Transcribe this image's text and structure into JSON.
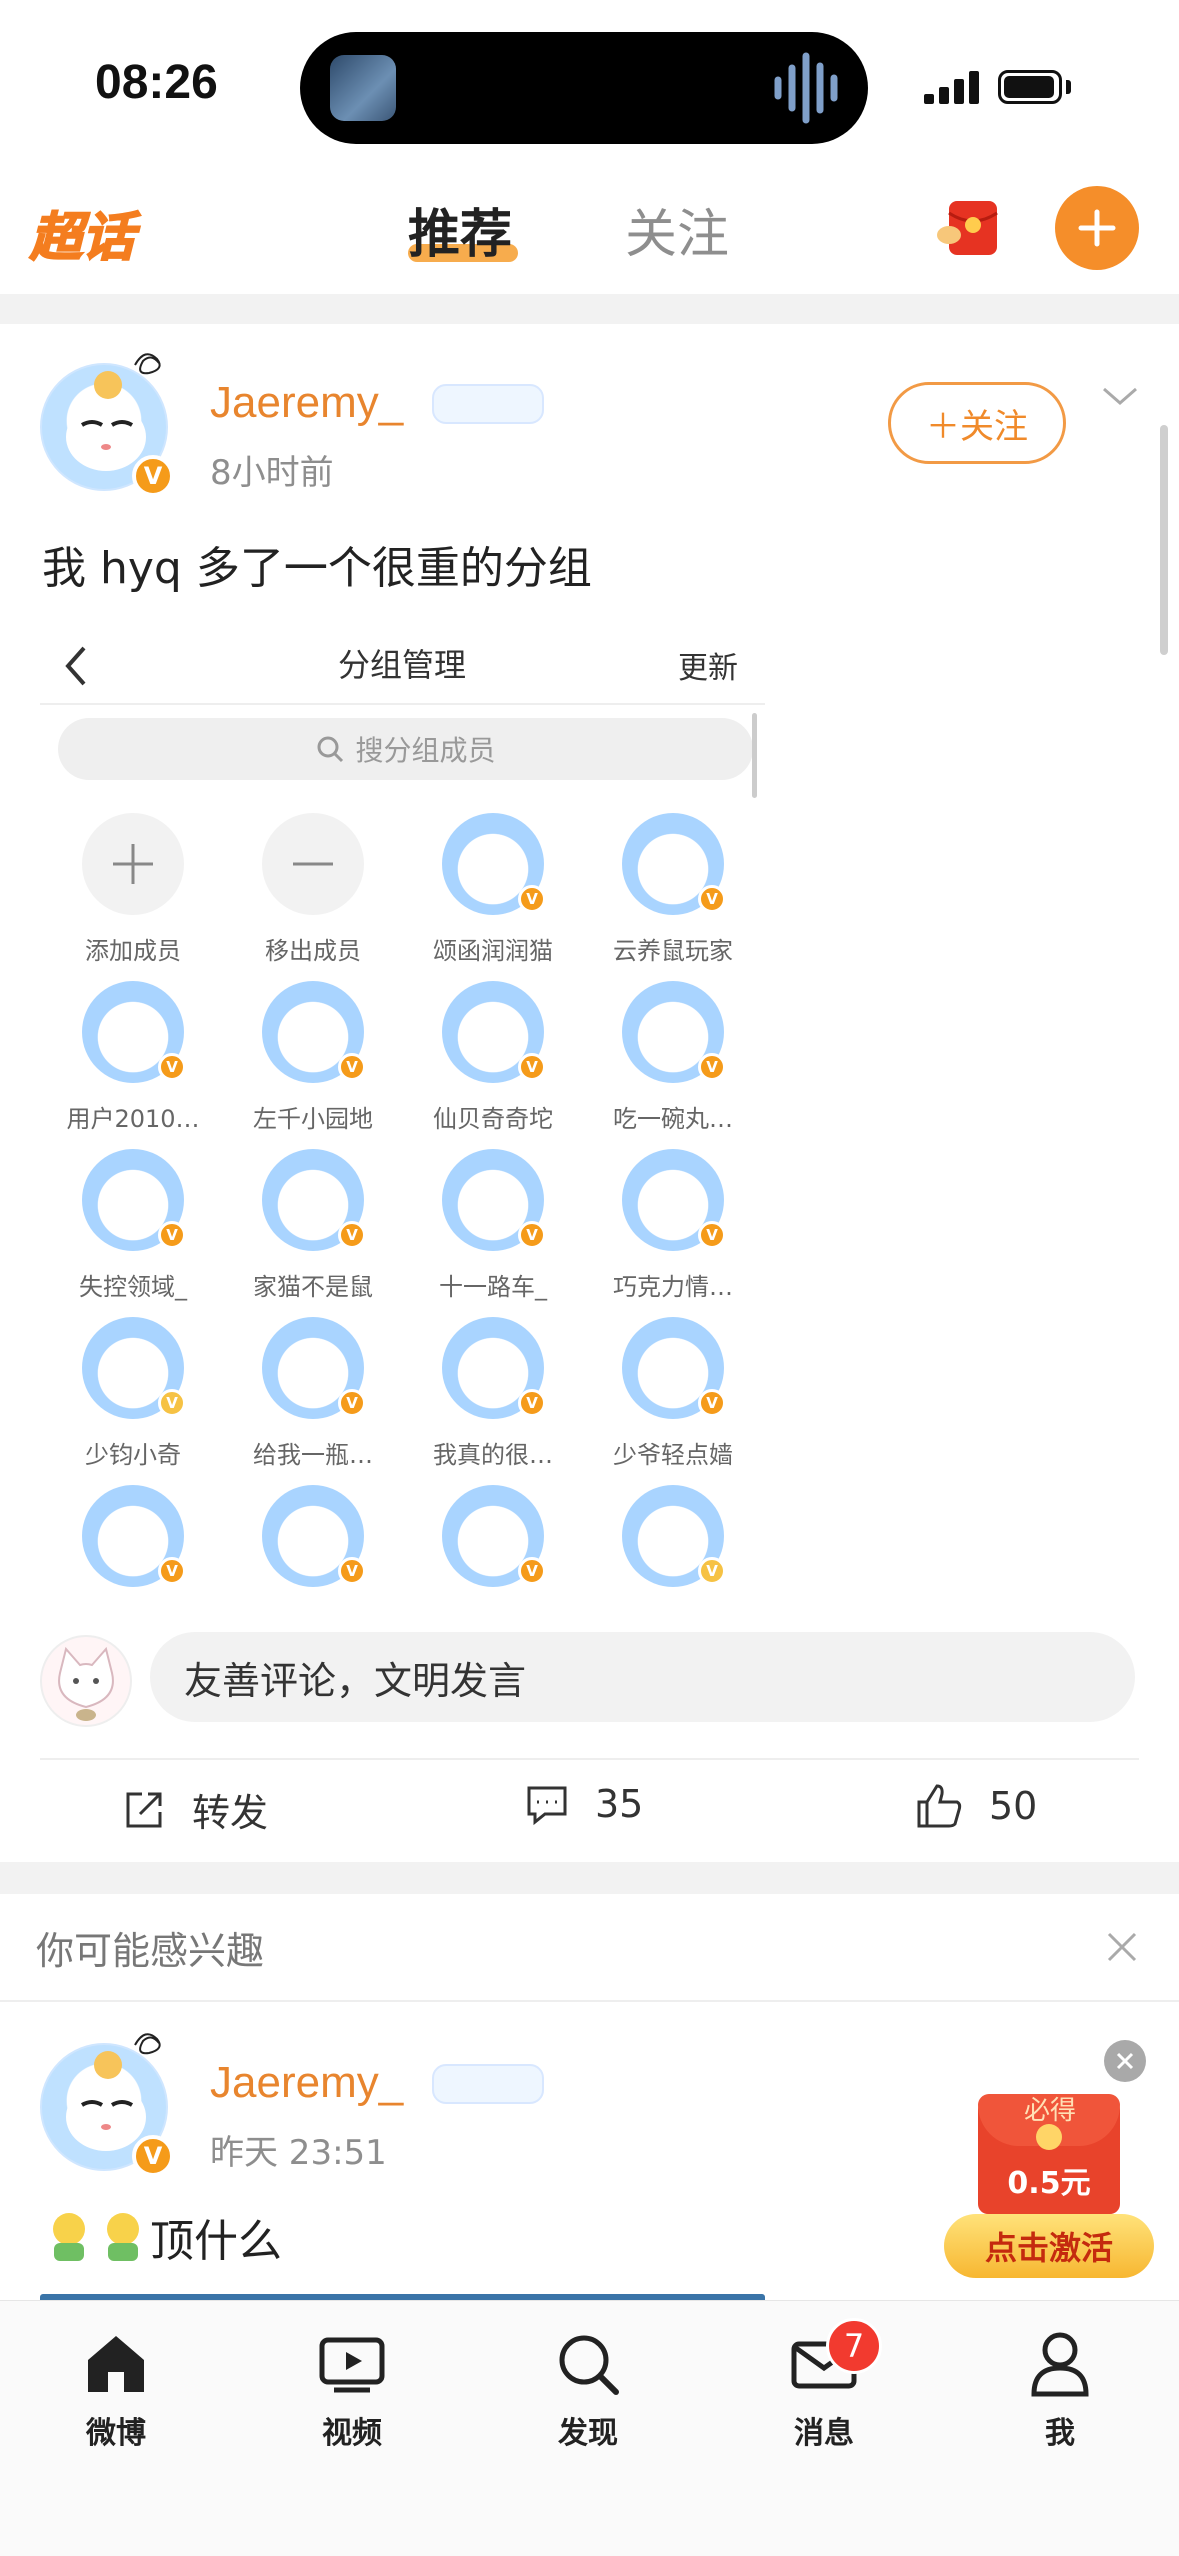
{
  "status_bar": {
    "time": "08:26"
  },
  "top_nav": {
    "logo_text": "超话",
    "tabs": [
      {
        "label": "推荐",
        "active": true
      },
      {
        "label": "关注",
        "active": false
      }
    ],
    "accent": "#f58e2a"
  },
  "post": {
    "username": "Jaeremy_",
    "time": "8小时前",
    "follow_label": "＋关注",
    "text": "我 hyq 多了一个很重的分组",
    "screenshot": {
      "title": "分组管理",
      "update_label": "更新",
      "search_placeholder": "搜分组成员",
      "members": [
        {
          "name": "添加成员"
        },
        {
          "name": "移出成员"
        },
        {
          "name": "颂函润润猫"
        },
        {
          "name": "云养鼠玩家"
        },
        {
          "name": "用户2010…"
        },
        {
          "name": "左千小园地"
        },
        {
          "name": "仙贝奇奇坨"
        },
        {
          "name": "吃一碗丸…"
        },
        {
          "name": "失控领域_"
        },
        {
          "name": "家猫不是鼠"
        },
        {
          "name": "十一路车_"
        },
        {
          "name": "巧克力情…"
        },
        {
          "name": "少钧小奇"
        },
        {
          "name": "给我一瓶…"
        },
        {
          "name": "我真的很…"
        },
        {
          "name": "少爷轻点嫱"
        },
        {
          "name": ""
        },
        {
          "name": ""
        },
        {
          "name": ""
        },
        {
          "name": ""
        }
      ]
    },
    "comment_placeholder": "友善评论，文明发言",
    "actions": {
      "repost_label": "转发",
      "comment_count": "35",
      "like_count": "50"
    }
  },
  "interest": {
    "title": "你可能感兴趣",
    "post": {
      "username": "Jaeremy_",
      "time": "昨天 23:51",
      "text": "顶什么"
    }
  },
  "promo": {
    "top_label": "必得",
    "amount": "0.5元",
    "button_label": "点击激活"
  },
  "tab_bar": {
    "items": [
      {
        "label": "微博",
        "icon": "home-icon"
      },
      {
        "label": "视频",
        "icon": "video-icon"
      },
      {
        "label": "发现",
        "icon": "search-icon"
      },
      {
        "label": "消息",
        "icon": "mail-icon"
      },
      {
        "label": "我",
        "icon": "person-icon"
      }
    ],
    "message_badge": "7"
  }
}
